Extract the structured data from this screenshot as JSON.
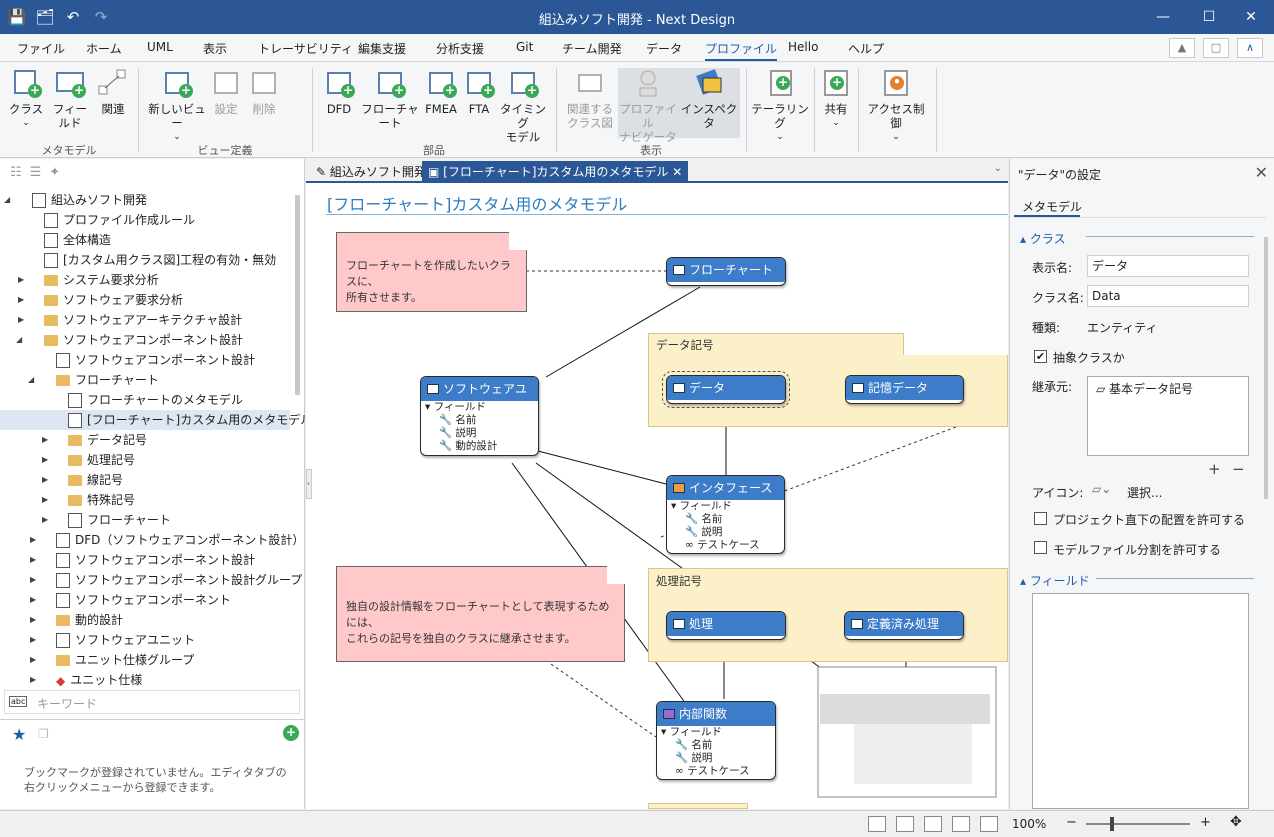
{
  "window": {
    "title": "組込みソフト開発 - Next Design"
  },
  "menu": {
    "items": [
      "ファイル",
      "ホーム",
      "UML",
      "表示",
      "トレーサビリティ",
      "編集支援",
      "分析支援",
      "Git",
      "チーム開発",
      "データ",
      "プロファイル",
      "Hello",
      "ヘルプ"
    ],
    "active": "プロファイル"
  },
  "ribbon": {
    "class": "クラス",
    "field": "フィールド",
    "relation": "関連",
    "group_metamodel": "メタモデル",
    "new_view": "新しいビュー",
    "settings": "設定",
    "delete": "削除",
    "group_viewdef": "ビュー定義",
    "dfd": "DFD",
    "flowchart": "フローチャート",
    "fmea": "FMEA",
    "fta": "FTA",
    "timing1": "タイミング",
    "timing2": "モデル",
    "group_parts": "部品",
    "related1": "関連する",
    "related2": "クラス図",
    "navi1": "プロファイル",
    "navi2": "ナビゲータ",
    "inspector": "インスペクタ",
    "group_display": "表示",
    "tailoring": "テーラリング",
    "share": "共有",
    "access": "アクセス制御"
  },
  "tree": {
    "items": [
      "組込みソフト開発",
      "プロファイル作成ルール",
      "全体構造",
      "[カスタム用クラス図]工程の有効・無効",
      "システム要求分析",
      "ソフトウェア要求分析",
      "ソフトウェアアーキテクチャ設計",
      "ソフトウェアコンポーネント設計",
      "ソフトウェアコンポーネント設計",
      "フローチャート",
      "フローチャートのメタモデル",
      "[フローチャート]カスタム用のメタモデル",
      "データ記号",
      "処理記号",
      "線記号",
      "特殊記号",
      "フローチャート",
      "DFD（ソフトウェアコンポーネント設計）",
      "ソフトウェアコンポーネント設計",
      "ソフトウェアコンポーネント設計グループ",
      "ソフトウェアコンポーネント",
      "動的設計",
      "ソフトウェアユニット",
      "ユニット仕様グループ",
      "ユニット仕様"
    ],
    "search_placeholder": "キーワード",
    "bookmark_empty": "ブックマークが登録されていません。エディタタブの右クリックメニューから登録できます。"
  },
  "tabs": {
    "tab1": "組込みソフト開発",
    "tab2": "[フローチャート]カスタム用のメタモデル"
  },
  "diagram": {
    "title": "[フローチャート]カスタム用のメタモデル",
    "note1": [
      "フローチャートを作成したいクラスに、",
      "所有させます。"
    ],
    "note2": [
      "独自の設計情報をフローチャートとして表現するためには、",
      "これらの記号を独自のクラスに継承させます。"
    ],
    "group_data": "データ記号",
    "group_process": "処理記号",
    "cls_flowchart": "フローチャート",
    "cls_swunit": "ソフトウェアユニット",
    "cls_data": "データ",
    "cls_storage": "記憶データ",
    "cls_interface": "インタフェースデータ",
    "cls_process": "処理",
    "cls_defined": "定義済み処理",
    "cls_internal": "内部関数",
    "fields_label": "フィールド",
    "f_name": "名前",
    "f_desc": "説明",
    "f_dyn": "動的設計",
    "f_test": "テストケース"
  },
  "props": {
    "header": "\"データ\"の設定",
    "tab": "メタモデル",
    "section_class": "クラス",
    "display_name_label": "表示名:",
    "display_name": "データ",
    "class_name_label": "クラス名:",
    "class_name": "Data",
    "kind_label": "種類:",
    "kind": "エンティティ",
    "abstract": "抽象クラスか",
    "abstract_checked": true,
    "inherit_label": "継承元:",
    "inherit_value": "基本データ記号",
    "icon_label": "アイコン:",
    "icon_select": "選択...",
    "allow_root": "プロジェクト直下の配置を許可する",
    "allow_split": "モデルファイル分割を許可する",
    "section_field": "フィールド"
  },
  "status": {
    "zoom": "100%"
  }
}
